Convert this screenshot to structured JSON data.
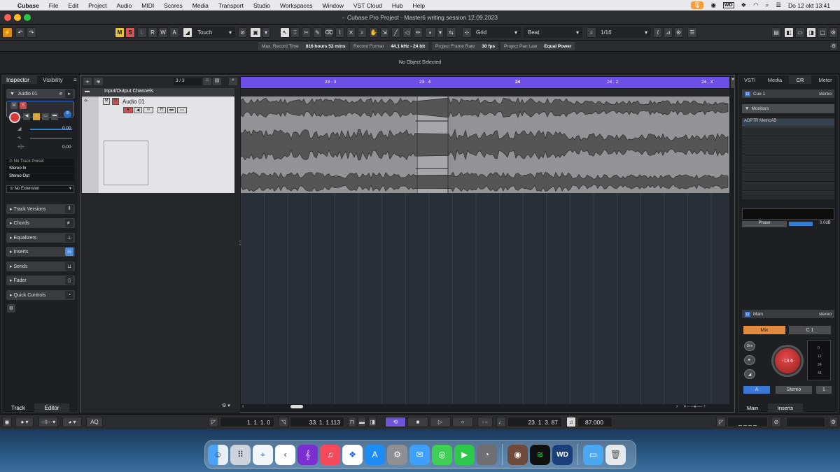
{
  "menubar": {
    "apple": "",
    "app": "Cubase",
    "items": [
      "File",
      "Edit",
      "Project",
      "Audio",
      "MIDI",
      "Scores",
      "Media",
      "Transport",
      "Studio",
      "Workspaces",
      "Window",
      "VST Cloud",
      "Hub",
      "Help"
    ],
    "clock": "Do 12 okt  13:41"
  },
  "window": {
    "title": "Cubase Pro Project - Master6 writing session 12.09.2023"
  },
  "toolbar": {
    "m": "M",
    "s": "S",
    "l": "L",
    "r": "R",
    "w": "W",
    "a": "A",
    "automation_mode": "Touch",
    "snap_type": "Grid",
    "grid_type": "Beat",
    "quantize": "1/16"
  },
  "infobar": [
    {
      "label": "Max. Record Time",
      "value": "816 hours 52 mins"
    },
    {
      "label": "Record Format",
      "value": "44.1 kHz - 24 bit"
    },
    {
      "label": "Project Frame Rate",
      "value": "30 fps"
    },
    {
      "label": "Project Pan Law",
      "value": "Equal Power"
    }
  ],
  "status": "No Object Selected",
  "inspector": {
    "tabs": [
      "Inspector",
      "Visibility"
    ],
    "track_name": "Audio 01",
    "fader_value": "0.00",
    "pan_value": "0.00",
    "preset": "No Track Preset",
    "input": "Stereo In",
    "output": "Stereo Out",
    "extension": "No Extension",
    "sections": [
      "Track Versions",
      "Chords",
      "Equalizers",
      "Inserts",
      "Sends",
      "Fader",
      "Quick Controls"
    ],
    "bottom_tabs": [
      "Track",
      "Editor"
    ]
  },
  "project": {
    "track_count": "3 / 3",
    "folder_name": "Input/Output Channels",
    "track_name": "Audio 01",
    "ruler_ticks": [
      "23 . 3",
      "23 . 4",
      "24",
      "24 . 2",
      "24 . 3"
    ]
  },
  "rightzone": {
    "tabs": [
      "VSTi",
      "Media",
      "CR",
      "Meter"
    ],
    "cue": {
      "name": "Cue 1",
      "format": "stereo"
    },
    "monitors_label": "Monitors",
    "monitor_item": "ADPTR MetricAB",
    "phase_label": "Phase",
    "phase_value": "0.0dB",
    "main": {
      "name": "Main",
      "format": "stereo"
    },
    "mix": "Mix",
    "c1": "C 1",
    "dim": "Dim",
    "knob_value": "-13.6",
    "meter_scale": [
      "0",
      "12",
      "24",
      "48"
    ],
    "a_btn": "A",
    "stereo_btn": "Stereo",
    "one_btn": "1",
    "bottom_tabs": [
      "Main",
      "Inserts"
    ]
  },
  "transport": {
    "left_locator": "1. 1. 1.   0",
    "right_locator": "33. 1. 1.113",
    "position": "23. 1. 3.  87",
    "tempo": "87.000",
    "time_display": "_ _ _ _",
    "aq": "AQ"
  },
  "dock": [
    "finder",
    "launchpad",
    "safari",
    "cubase",
    "harmony",
    "music",
    "dropbox",
    "app-store",
    "settings",
    "mail",
    "messages",
    "facetime",
    "recorder",
    "mixer",
    "spotify",
    "wd",
    "folder",
    "trash"
  ]
}
